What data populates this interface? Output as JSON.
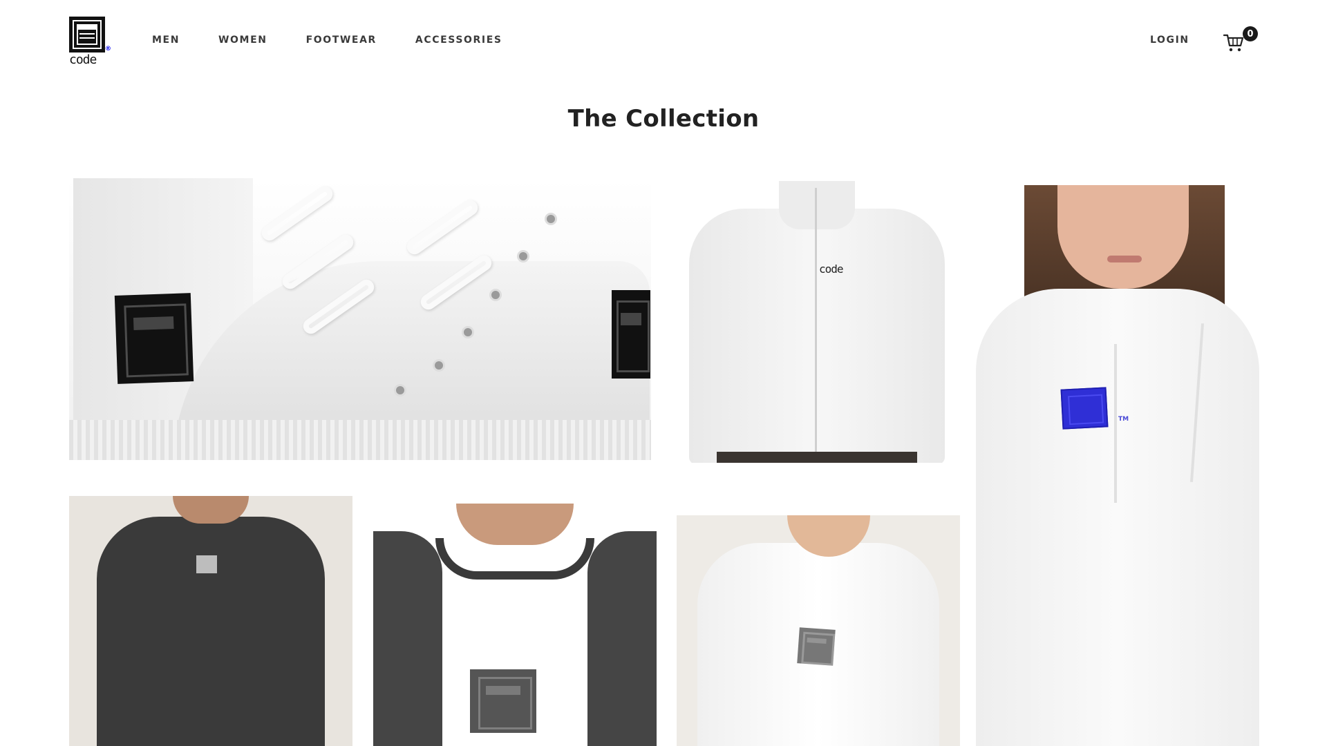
{
  "header": {
    "logo": {
      "mark_icon": "code-brand-logo",
      "wordmark": "code",
      "registered": "®",
      "trademark": "TM"
    },
    "nav": [
      {
        "label": "MEN"
      },
      {
        "label": "WOMEN"
      },
      {
        "label": "FOOTWEAR"
      },
      {
        "label": "ACCESSORIES"
      }
    ],
    "login_label": "LOGIN",
    "cart": {
      "icon": "shopping-cart-icon",
      "count": "0"
    }
  },
  "main": {
    "title": "The Collection",
    "products": [
      {
        "id": "sneakers",
        "image": "white-high-top-sneakers"
      },
      {
        "id": "zip-jacket",
        "image": "white-zip-jacket",
        "print": "code"
      },
      {
        "id": "hoodie",
        "image": "white-hoodie-woman",
        "print_color": "#2f2fd6",
        "print_mark": "TM"
      },
      {
        "id": "dark-tee",
        "image": "dark-grey-tshirt"
      },
      {
        "id": "raglan",
        "image": "white-raglan-tee-dark-sleeves"
      },
      {
        "id": "sweatshirt",
        "image": "white-sweatshirt"
      }
    ]
  },
  "colors": {
    "text": "#3a3a3a",
    "title": "#222222",
    "badge": "#1a1a1a",
    "background": "#ffffff"
  }
}
